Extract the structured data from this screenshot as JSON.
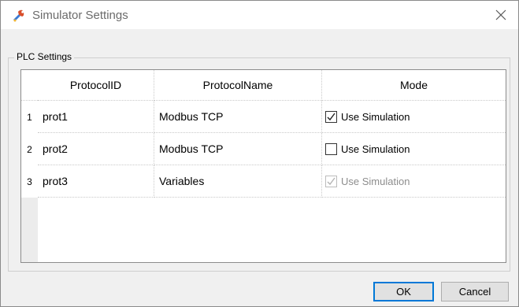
{
  "window": {
    "title": "Simulator Settings",
    "icon": "tools-icon",
    "close_icon": "close-icon"
  },
  "group": {
    "label": "PLC Settings"
  },
  "grid": {
    "columns": [
      "ProtocolID",
      "ProtocolName",
      "Mode"
    ],
    "rows": [
      {
        "num": "1",
        "id": "prot1",
        "name": "Modbus TCP",
        "mode": "Use Simulation",
        "checked": true,
        "enabled": true
      },
      {
        "num": "2",
        "id": "prot2",
        "name": "Modbus TCP",
        "mode": "Use Simulation",
        "checked": false,
        "enabled": true
      },
      {
        "num": "3",
        "id": "prot3",
        "name": "Variables",
        "mode": "Use Simulation",
        "checked": true,
        "enabled": false
      }
    ]
  },
  "buttons": {
    "ok": "OK",
    "cancel": "Cancel"
  },
  "colors": {
    "accent": "#0078d7",
    "dialog_bg": "#f0f0f0"
  }
}
